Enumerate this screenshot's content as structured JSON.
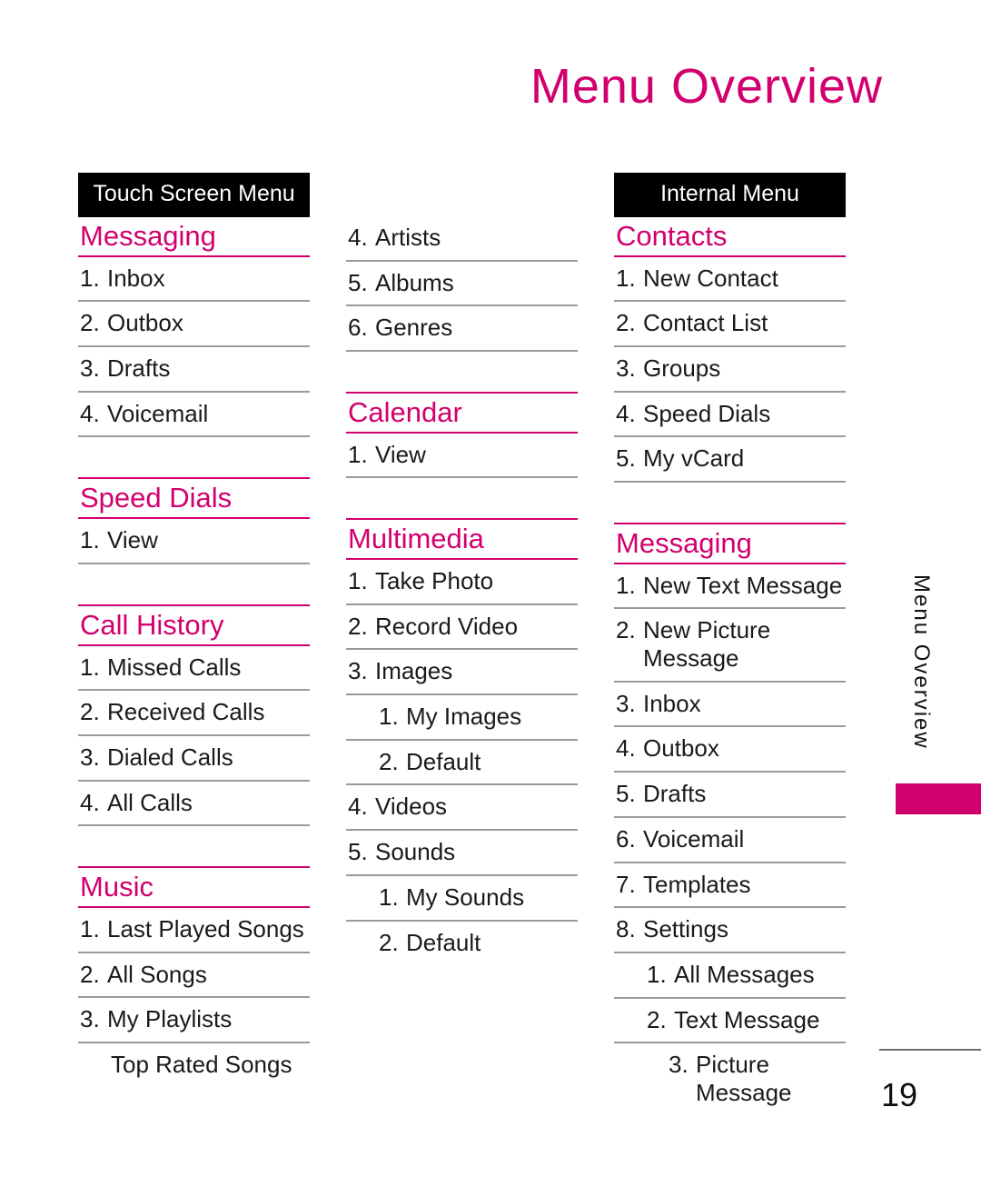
{
  "page": {
    "title": "Menu Overview",
    "side_tab_label": "Menu Overview",
    "page_number": "19",
    "accent_color": "#d2006e",
    "banner_bg": "#000000",
    "banner_fg": "#ffffff",
    "rule_color": "#9a9a9a"
  },
  "columns": [
    {
      "banner": "Touch Screen Menu",
      "blocks": [
        {
          "kind": "section",
          "title": "Messaging",
          "rows": [
            {
              "num": "1.",
              "text": "Inbox",
              "indent": 0
            },
            {
              "num": "2.",
              "text": "Outbox",
              "indent": 0
            },
            {
              "num": "3.",
              "text": "Drafts",
              "indent": 0
            },
            {
              "num": "4.",
              "text": "Voicemail",
              "indent": 0
            }
          ]
        },
        {
          "kind": "section",
          "title": "Speed Dials",
          "rows": [
            {
              "num": "1.",
              "text": "View",
              "indent": 0
            }
          ]
        },
        {
          "kind": "section",
          "title": "Call History",
          "rows": [
            {
              "num": "1.",
              "text": "Missed Calls",
              "indent": 0
            },
            {
              "num": "2.",
              "text": "Received Calls",
              "indent": 0
            },
            {
              "num": "3.",
              "text": "Dialed Calls",
              "indent": 0
            },
            {
              "num": "4.",
              "text": "All Calls",
              "indent": 0
            }
          ]
        },
        {
          "kind": "section",
          "title": "Music",
          "rows": [
            {
              "num": "1.",
              "text": "Last Played Songs",
              "indent": 0
            },
            {
              "num": "2.",
              "text": "All Songs",
              "indent": 0
            },
            {
              "num": "3.",
              "text": "My Playlists",
              "indent": 0
            },
            {
              "num": "",
              "text": "Top Rated Songs",
              "indent": 0,
              "no_rule": true
            }
          ]
        }
      ]
    },
    {
      "banner": "",
      "blocks": [
        {
          "kind": "continuation",
          "title": "",
          "rows": [
            {
              "num": "4.",
              "text": "Artists",
              "indent": 0
            },
            {
              "num": "5.",
              "text": "Albums",
              "indent": 0
            },
            {
              "num": "6.",
              "text": "Genres",
              "indent": 0
            }
          ]
        },
        {
          "kind": "section",
          "title": "Calendar",
          "rows": [
            {
              "num": "1.",
              "text": "View",
              "indent": 0
            }
          ]
        },
        {
          "kind": "section",
          "title": "Multimedia",
          "rows": [
            {
              "num": "1.",
              "text": "Take Photo",
              "indent": 0
            },
            {
              "num": "2.",
              "text": "Record Video",
              "indent": 0
            },
            {
              "num": "3.",
              "text": "Images",
              "indent": 0
            },
            {
              "num": "1.",
              "text": "My Images",
              "indent": 1
            },
            {
              "num": "2.",
              "text": "Default",
              "indent": 1
            },
            {
              "num": "4.",
              "text": "Videos",
              "indent": 0
            },
            {
              "num": "5.",
              "text": "Sounds",
              "indent": 0
            },
            {
              "num": "1.",
              "text": "My Sounds",
              "indent": 1
            },
            {
              "num": "2.",
              "text": "Default",
              "indent": 1,
              "no_rule": true
            }
          ]
        }
      ]
    },
    {
      "banner": "Internal Menu",
      "blocks": [
        {
          "kind": "section",
          "title": "Contacts",
          "rows": [
            {
              "num": "1.",
              "text": "New Contact",
              "indent": 0
            },
            {
              "num": "2.",
              "text": "Contact List",
              "indent": 0
            },
            {
              "num": "3.",
              "text": "Groups",
              "indent": 0
            },
            {
              "num": "4.",
              "text": "Speed Dials",
              "indent": 0
            },
            {
              "num": "5.",
              "text": "My vCard",
              "indent": 0
            }
          ]
        },
        {
          "kind": "section",
          "title": "Messaging",
          "rows": [
            {
              "num": "1.",
              "text": "New Text Message",
              "indent": 0
            },
            {
              "num": "2.",
              "text": "New Picture Message",
              "indent": 0
            },
            {
              "num": "3.",
              "text": "Inbox",
              "indent": 0
            },
            {
              "num": "4.",
              "text": "Outbox",
              "indent": 0
            },
            {
              "num": "5.",
              "text": "Drafts",
              "indent": 0
            },
            {
              "num": "6.",
              "text": "Voicemail",
              "indent": 0
            },
            {
              "num": "7.",
              "text": "Templates",
              "indent": 0
            },
            {
              "num": "8.",
              "text": "Settings",
              "indent": 0
            },
            {
              "num": "1.",
              "text": "All Messages",
              "indent": 1
            },
            {
              "num": "2.",
              "text": "Text Message",
              "indent": 1
            },
            {
              "num": "3.",
              "text": "Picture Message",
              "indent": 2,
              "no_rule": true
            }
          ]
        }
      ]
    }
  ]
}
